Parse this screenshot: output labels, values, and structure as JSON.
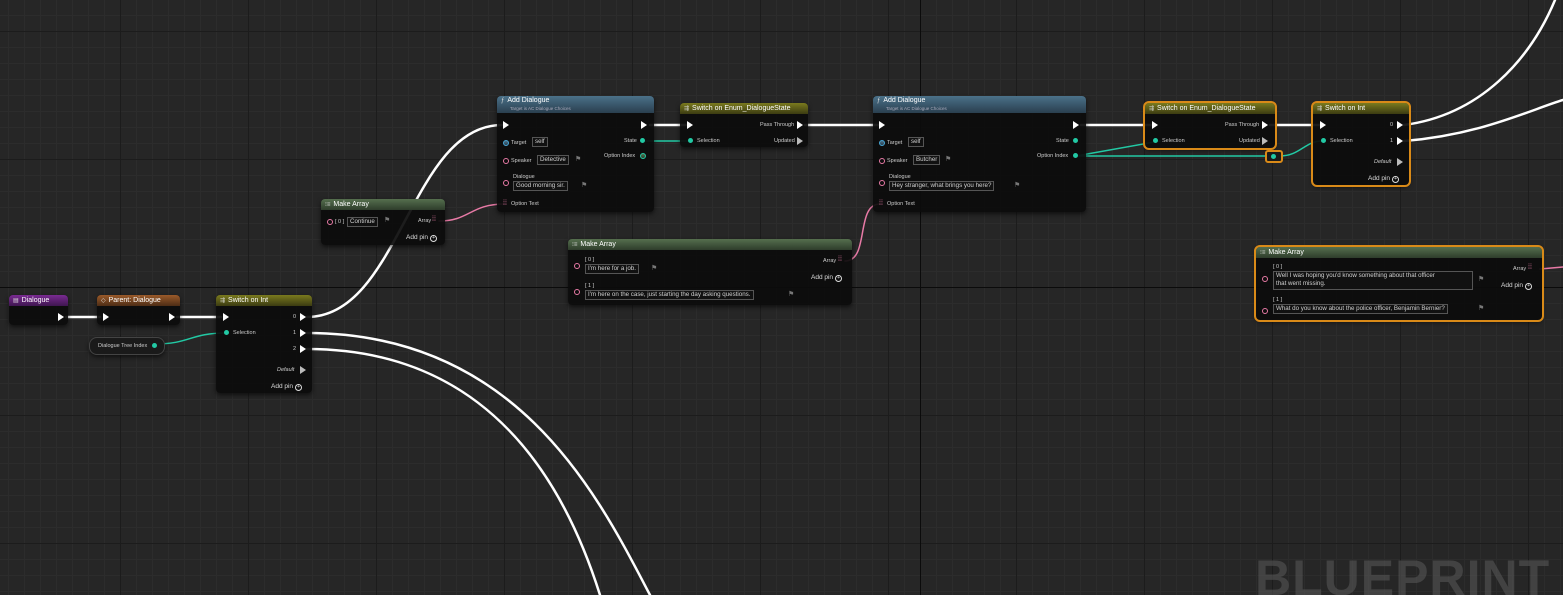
{
  "nodes": {
    "dialogue_var": {
      "title": "Dialogue"
    },
    "parent_dialogue": {
      "title": "Parent: Dialogue"
    },
    "dialogue_tree_index": {
      "label": "Dialogue Tree Index"
    },
    "switch_int_1": {
      "title": "Switch on Int",
      "selection": "Selection",
      "out0": "0",
      "out1": "1",
      "out2": "2",
      "default": "Default",
      "add_pin": "Add pin"
    },
    "make_array_1": {
      "title": "Make Array",
      "index0": "[ 0 ]",
      "value0": "Continue",
      "array": "Array",
      "add_pin": "Add pin"
    },
    "add_dialogue_1": {
      "title": "Add Dialogue",
      "subtitle": "Target is AC Dialogue Choices",
      "target": "Target",
      "target_val": "self",
      "speaker": "Speaker",
      "speaker_val": "Detective",
      "dialogue": "Dialogue",
      "dialogue_val": "Good morning sir.",
      "option_text": "Option Text",
      "state": "State",
      "option_index": "Option Index"
    },
    "switch_enum_1": {
      "title": "Switch on Enum_DialogueState",
      "pass_through": "Pass Through",
      "selection": "Selection",
      "updated": "Updated"
    },
    "make_array_2": {
      "title": "Make Array",
      "index0": "[ 0 ]",
      "value0": "I'm here for a job.",
      "index1": "[ 1 ]",
      "value1": "I'm here on the case, just starting the day asking questions.",
      "array": "Array",
      "add_pin": "Add pin"
    },
    "add_dialogue_2": {
      "title": "Add Dialogue",
      "subtitle": "Target is AC Dialogue Choices",
      "target": "Target",
      "target_val": "self",
      "speaker": "Speaker",
      "speaker_val": "Butcher",
      "dialogue": "Dialogue",
      "dialogue_val": "Hey stranger, what brings you here?",
      "option_text": "Option Text",
      "state": "State",
      "option_index": "Option Index"
    },
    "switch_enum_2": {
      "title": "Switch on Enum_DialogueState",
      "pass_through": "Pass Through",
      "selection": "Selection",
      "updated": "Updated"
    },
    "switch_int_2": {
      "title": "Switch on Int",
      "selection": "Selection",
      "out0": "0",
      "out1": "1",
      "default": "Default",
      "add_pin": "Add pin"
    },
    "make_array_3": {
      "title": "Make Array",
      "index0": "[ 0 ]",
      "value0a": "Well I was hoping you'd know something about that officer",
      "value0b": "that went missing.",
      "index1": "[ 1 ]",
      "value1": "What do you know about the police officer, Benjamin Bernier?",
      "array": "Array",
      "add_pin": "Add pin"
    }
  },
  "watermark": "BLUEPRINT",
  "colors": {
    "exec": "#ffffff",
    "int_pin": "#22c9a4",
    "string_pin": "#e87aa6",
    "selection_outline": "#d98a18"
  }
}
